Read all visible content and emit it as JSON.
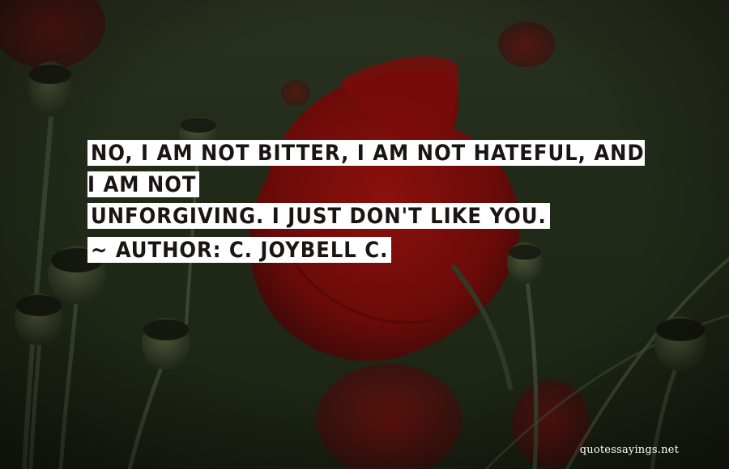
{
  "quote": {
    "line1": "No, I am not bitter, I am not hateful, and I am not",
    "line2": "unforgiving. I just don't like you.",
    "author_prefix": "~ Author:",
    "author_name": "C. JoyBell C."
  },
  "watermark": "quotessayings.net",
  "colors": {
    "background_green": "#222b1a",
    "poppy_red": "#7a0d0b",
    "text_highlight": "#ffffff",
    "text": "#1a1414"
  }
}
